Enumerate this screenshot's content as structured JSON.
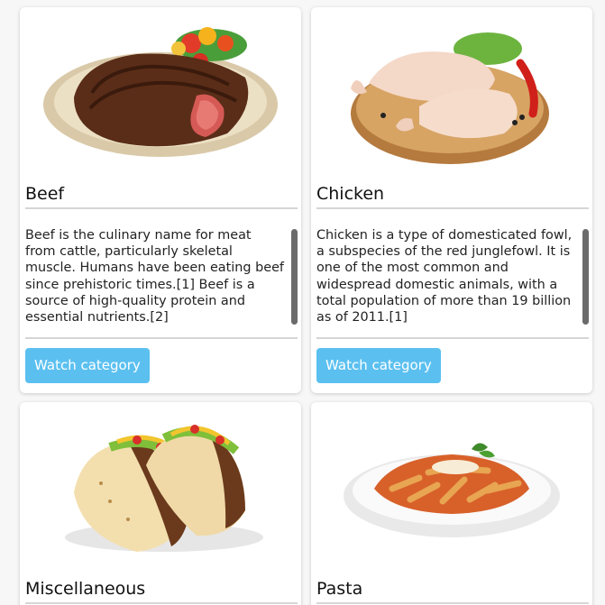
{
  "categories": [
    {
      "name": "Beef",
      "description": "Beef is the culinary name for meat from cattle, particularly skeletal muscle. Humans have been eating beef since prehistoric times.[1] Beef is a source of high-quality protein and essential nutrients.[2]",
      "button_label": "Watch category",
      "image": "steak-plate"
    },
    {
      "name": "Chicken",
      "description": "Chicken is a type of domesticated fowl, a subspecies of the red junglefowl. It is one of the most common and widespread domestic animals, with a total population of more than 19 billion as of 2011.[1]",
      "button_label": "Watch category",
      "image": "chicken-legs-board"
    },
    {
      "name": "Miscellaneous",
      "image": "tacos"
    },
    {
      "name": "Pasta",
      "image": "pasta-bowl"
    }
  ],
  "colors": {
    "button": "#5bc0f0",
    "divider": "#d6d6d6",
    "background": "#f7f7f7"
  }
}
